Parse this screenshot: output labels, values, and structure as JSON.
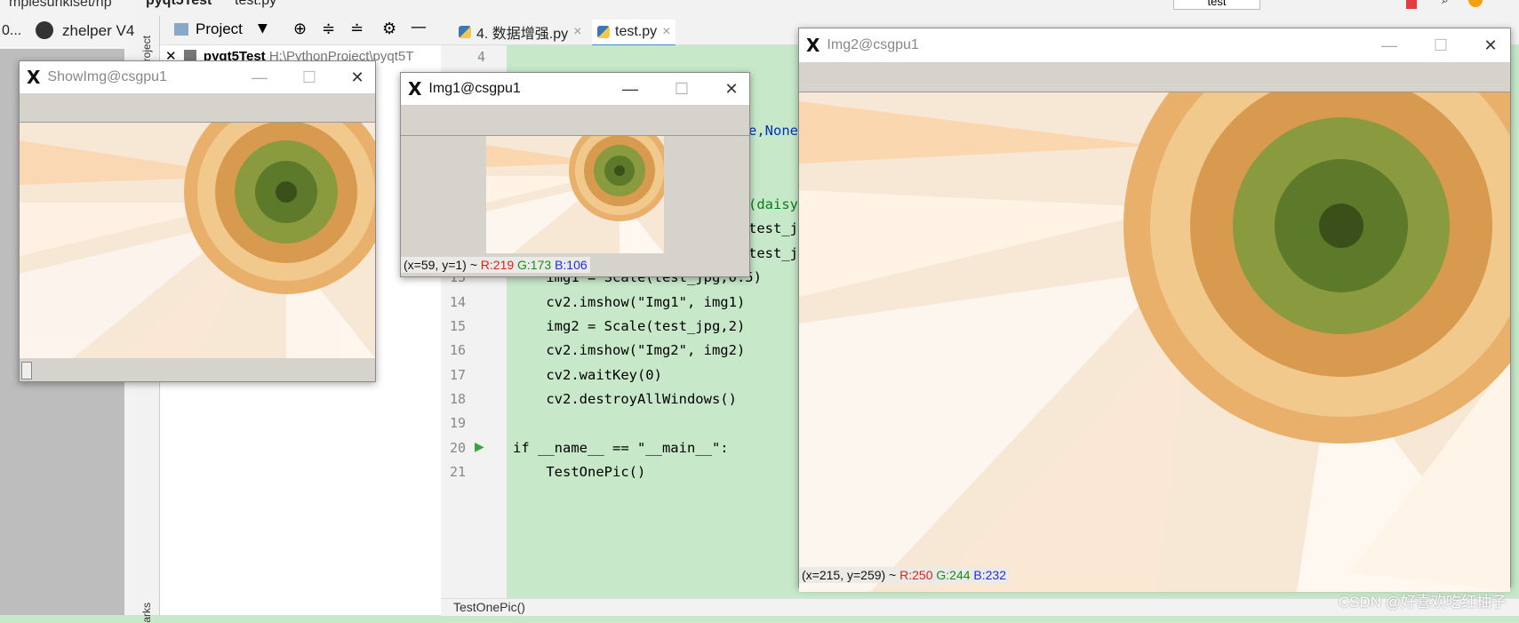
{
  "browser": {
    "url_fragment": "mpiesurikiset/np",
    "back_label": "0...",
    "tab_label": "zhelper V4"
  },
  "ide": {
    "breadcrumb_project": "pyqt5Test",
    "breadcrumb_file": "test.py",
    "project_button": "Project",
    "project_root": "pyqt5Test",
    "project_path": "H:\\PythonProject\\pyqt5T",
    "side_tab_project": "Project",
    "side_tab_bookmarks": "arks",
    "run_config": "test",
    "tabs": [
      {
        "label": "4. 数据增强.py",
        "active": false
      },
      {
        "label": "test.py",
        "active": true
      }
    ],
    "status_text": "TestOnePic()",
    "lines": [
      {
        "n": "4",
        "code": ""
      },
      {
        "n": "13",
        "code": "    img1 = Scale(test_jpg,0.5)"
      },
      {
        "n": "14",
        "code": "    cv2.imshow(\"Img1\", img1)"
      },
      {
        "n": "15",
        "code": "    img2 = Scale(test_jpg,2)"
      },
      {
        "n": "16",
        "code": "    cv2.imshow(\"Img2\", img2)"
      },
      {
        "n": "17",
        "code": "    cv2.waitKey(0)"
      },
      {
        "n": "18",
        "code": "    cv2.destroyAllWindows()"
      },
      {
        "n": "19",
        "code": ""
      },
      {
        "n": "20",
        "code": "if __name__ == \"__main__\":"
      },
      {
        "n": "21",
        "code": "    TestOnePic()"
      }
    ],
    "hidden_fragments": [
      "e,None",
      "(daisy",
      "test_jp",
      "test_j"
    ]
  },
  "windows": {
    "showimg": {
      "title": "ShowImg@csgpu1"
    },
    "img1": {
      "title": "Img1@csgpu1",
      "coords": "(x=59, y=1) ~",
      "r": "R:219",
      "g": "G:173",
      "b": "B:106"
    },
    "img2": {
      "title": "Img2@csgpu1",
      "coords": "(x=215, y=259) ~",
      "r": "R:250",
      "g": "G:244",
      "b": "B:232"
    }
  },
  "watermark": "CSDN @好喜欢吃红柚子",
  "colors": {
    "editor_bg": "#c7e9c9",
    "window_bg": "#d6d2cc",
    "red": "#e0201a",
    "green": "#1b8a1b",
    "blue": "#1a30e0"
  }
}
